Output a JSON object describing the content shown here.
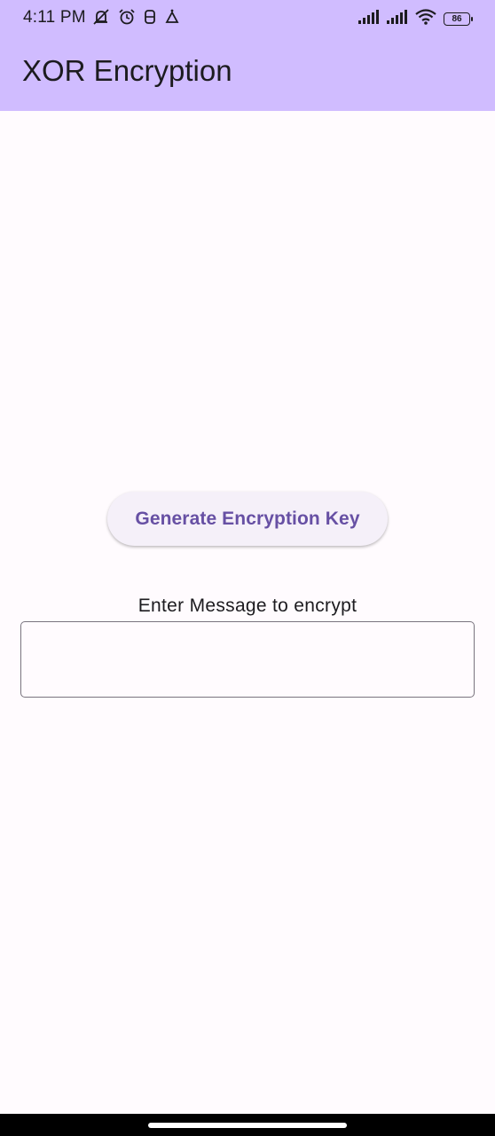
{
  "status_bar": {
    "time": "4:11 PM",
    "battery": "86",
    "left_icons": [
      "mute-icon",
      "alarm-icon",
      "sim-icon",
      "notification-icon"
    ],
    "right_icons": [
      "signal-icon",
      "signal-icon",
      "wifi-icon",
      "battery-icon"
    ]
  },
  "app_bar": {
    "title": "XOR Encryption",
    "background": "#d0bcff"
  },
  "main": {
    "generate_button_label": "Generate Encryption Key",
    "message_label": "Enter Message to encrypt",
    "message_value": ""
  },
  "colors": {
    "accent": "#6750a4",
    "background": "#fffbfe"
  }
}
